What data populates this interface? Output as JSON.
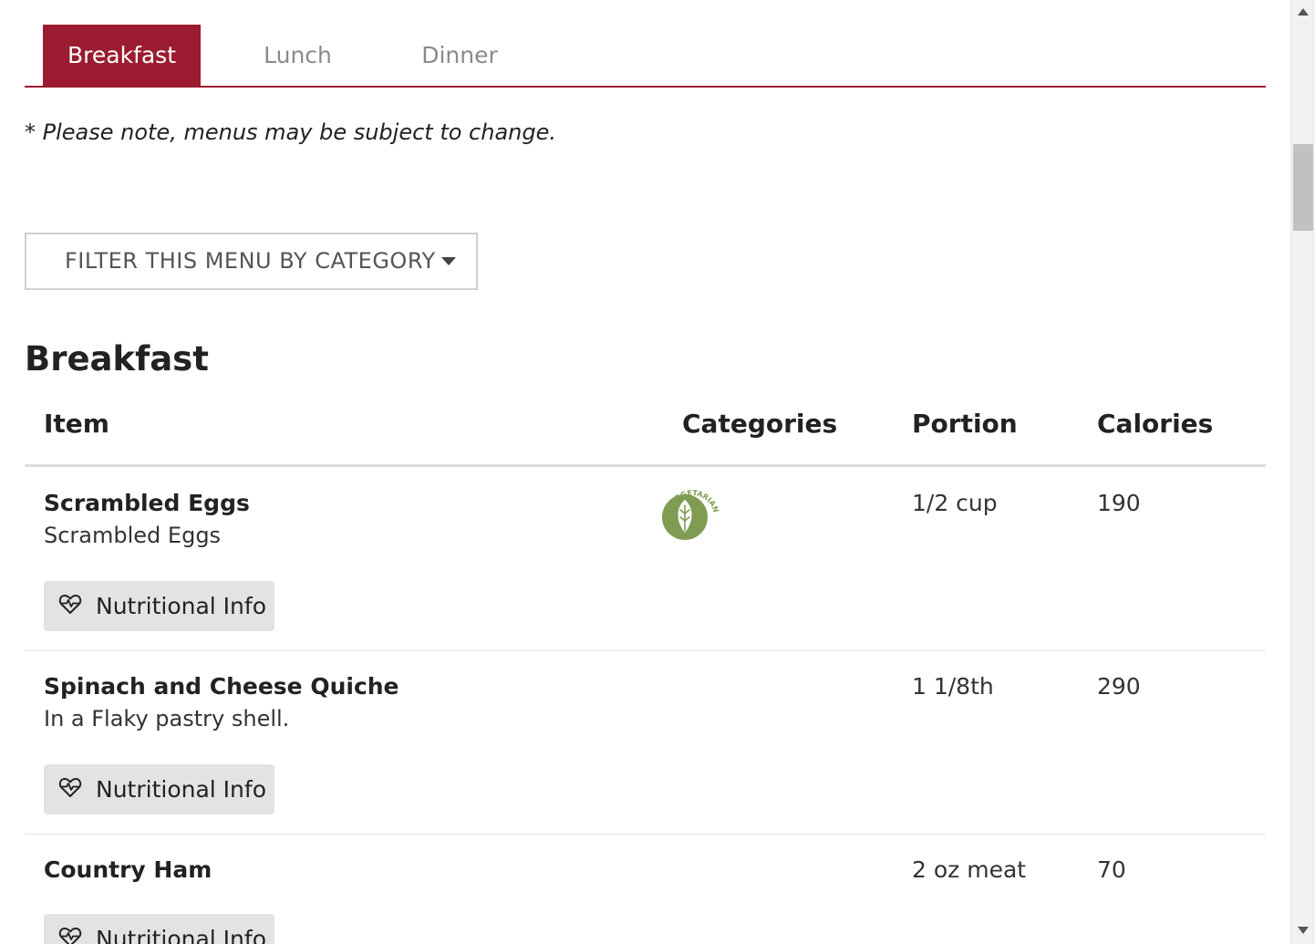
{
  "tabs": [
    {
      "label": "Breakfast",
      "active": true
    },
    {
      "label": "Lunch",
      "active": false
    },
    {
      "label": "Dinner",
      "active": false
    }
  ],
  "note": "* Please note, menus may be subject to change.",
  "filter": {
    "label": "FILTER THIS MENU BY CATEGORY",
    "icon": "chevron-down-icon"
  },
  "section": {
    "title": "Breakfast"
  },
  "table": {
    "headers": {
      "item": "Item",
      "categories": "Categories",
      "portion": "Portion",
      "calories": "Calories"
    },
    "rows": [
      {
        "name": "Scrambled Eggs",
        "description": "Scrambled Eggs",
        "category_badge": "VEGETARIAN",
        "portion": "1/2 cup",
        "calories": "190",
        "button": "Nutritional Info"
      },
      {
        "name": "Spinach and Cheese Quiche",
        "description": "In a Flaky pastry shell.",
        "portion": "1 1/8th",
        "calories": "290",
        "button": "Nutritional Info"
      },
      {
        "name": "Country Ham",
        "portion": "2 oz meat",
        "calories": "70",
        "button": "Nutritional Info"
      }
    ]
  },
  "colors": {
    "accent": "#9b1c31",
    "vegetarian": "#7f9c52",
    "button_bg": "#e3e3e3"
  },
  "icons": {
    "nutrition": "heart-pulse-icon",
    "vegetarian": "leaf-icon"
  }
}
